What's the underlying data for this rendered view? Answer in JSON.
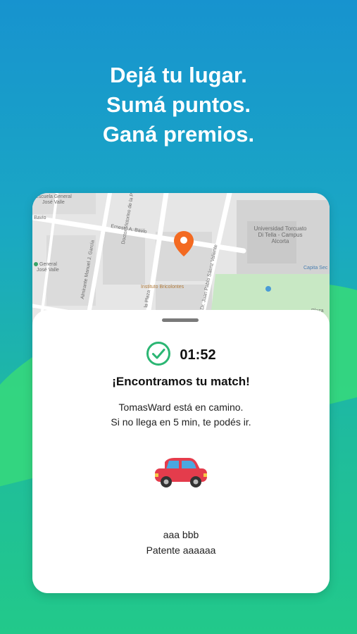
{
  "headline": {
    "line1": "Dejá tu lugar.",
    "line2": "Sumá puntos.",
    "line3": "Ganá premios."
  },
  "map": {
    "labels": {
      "school_top": "Escuela General",
      "school_top_2": "José Valle",
      "street_bavio_left": "Bavio",
      "street_bavio": "Ernesto A. Bavio",
      "street_plaza": "Doctor Victorino de la Plaza",
      "street_garcia": "Almirante Manuel J. García",
      "street_valiente": "Dr. Juan Pablo Sáenz Valiente",
      "street_plaza_lower": "la Plaza",
      "school_left": "General",
      "school_left_2": "José Valle",
      "institute": "Instituto Bricolontes",
      "university": "Universidad Torcuato Di Tella - Campus Alcorta",
      "capital": "Capita Sec",
      "plaza": "Plaza"
    },
    "pin_icon": "location-pin-icon",
    "pin_color": "#f36a21"
  },
  "status": {
    "timer": "01:52",
    "check_icon": "check-circle-icon",
    "check_color": "#2bb673"
  },
  "match": {
    "title": "¡Encontramos tu match!",
    "line1": "TomasWard está en camino.",
    "line2": "Si no llega en 5 min, te podés ir."
  },
  "car": {
    "icon": "car-icon",
    "body_color": "#e43c4c",
    "window_color": "#4aa8e0"
  },
  "driver": {
    "name": "aaa bbb",
    "plate": "Patente aaaaaa"
  }
}
